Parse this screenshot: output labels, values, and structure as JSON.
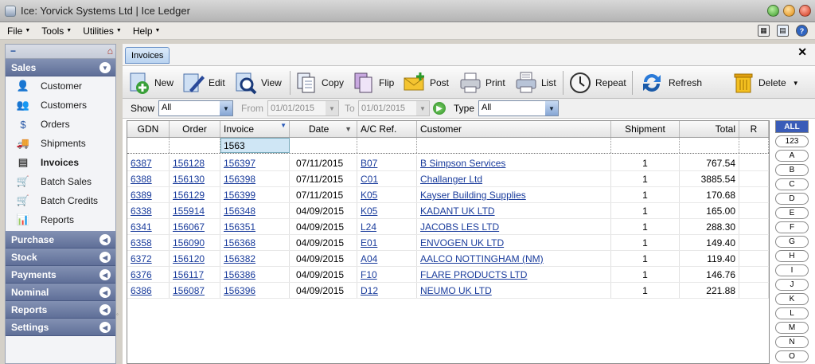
{
  "window": {
    "title": "Ice: Yorvick Systems Ltd | Ice Ledger"
  },
  "menu": [
    "File",
    "Tools",
    "Utilities",
    "Help"
  ],
  "sidebar": {
    "sections": [
      {
        "label": "Sales",
        "items": [
          "Customer",
          "Customers",
          "Orders",
          "Shipments",
          "Invoices",
          "Batch Sales",
          "Batch Credits",
          "Reports"
        ]
      },
      {
        "label": "Purchase"
      },
      {
        "label": "Stock"
      },
      {
        "label": "Payments"
      },
      {
        "label": "Nominal"
      },
      {
        "label": "Reports"
      },
      {
        "label": "Settings"
      }
    ],
    "selected": "Invoices"
  },
  "tab": {
    "label": "Invoices"
  },
  "toolbar": {
    "new": "New",
    "edit": "Edit",
    "view": "View",
    "copy": "Copy",
    "flip": "Flip",
    "post": "Post",
    "print": "Print",
    "list": "List",
    "repeat": "Repeat",
    "refresh": "Refresh",
    "delete": "Delete"
  },
  "filter": {
    "show_label": "Show",
    "show_value": "All",
    "from_label": "From",
    "from_value": "01/01/2015",
    "to_label": "To",
    "to_value": "01/01/2015",
    "type_label": "Type",
    "type_value": "All"
  },
  "table": {
    "columns": [
      "GDN",
      "Order",
      "Invoice",
      "Date",
      "A/C Ref.",
      "Customer",
      "Shipment",
      "Total",
      "R"
    ],
    "filter_invoice": "1563",
    "rows": [
      [
        "6387",
        "156128",
        "156397",
        "07/11/2015",
        "B07",
        "B Simpson Services",
        "1",
        "767.54"
      ],
      [
        "6388",
        "156130",
        "156398",
        "07/11/2015",
        "C01",
        "Challanger Ltd",
        "1",
        "3885.54"
      ],
      [
        "6389",
        "156129",
        "156399",
        "07/11/2015",
        "K05",
        "Kayser Building Supplies",
        "1",
        "170.68"
      ],
      [
        "6338",
        "155914",
        "156348",
        "04/09/2015",
        "K05",
        "KADANT UK LTD",
        "1",
        "165.00"
      ],
      [
        "6341",
        "156067",
        "156351",
        "04/09/2015",
        "L24",
        "JACOBS LES LTD",
        "1",
        "288.30"
      ],
      [
        "6358",
        "156090",
        "156368",
        "04/09/2015",
        "E01",
        "ENVOGEN UK LTD",
        "1",
        "149.40"
      ],
      [
        "6372",
        "156120",
        "156382",
        "04/09/2015",
        "A04",
        "AALCO NOTTINGHAM (NM)",
        "1",
        "119.40"
      ],
      [
        "6376",
        "156117",
        "156386",
        "04/09/2015",
        "F10",
        "FLARE PRODUCTS LTD",
        "1",
        "146.76"
      ],
      [
        "6386",
        "156087",
        "156396",
        "04/09/2015",
        "D12",
        "NEUMO UK LTD",
        "1",
        "221.88"
      ]
    ]
  },
  "alpha": [
    "ALL",
    "123",
    "A",
    "B",
    "C",
    "D",
    "E",
    "F",
    "G",
    "H",
    "I",
    "J",
    "K",
    "L",
    "M",
    "N",
    "O"
  ]
}
